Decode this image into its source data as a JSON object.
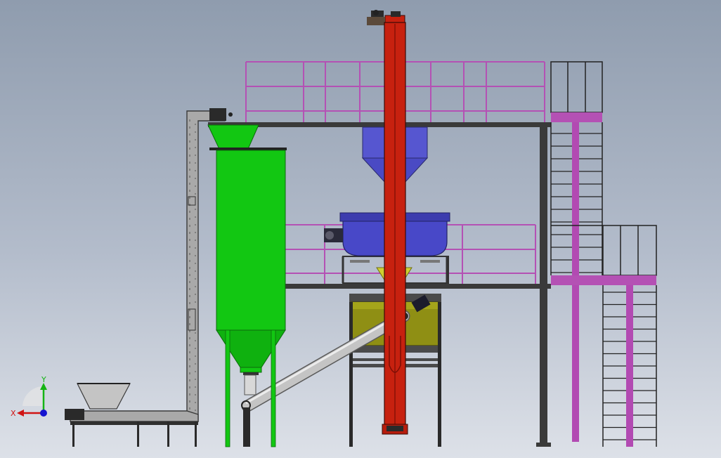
{
  "triad": {
    "x_label": "X",
    "y_label": "Y"
  },
  "colors": {
    "bucket_elevator": "#c7210f",
    "silo": "#12c712",
    "mixer": "#4848c8",
    "hopper_blue": "#5656d0",
    "platform_rails": "#b451b4",
    "stair_stringer": "#b24ab2",
    "packing_machine": "#8f8f14",
    "screw_conveyor": "#c4c4c4",
    "frame_steel": "#3a3a3a",
    "axis_x": "#d01414",
    "axis_y": "#14b414",
    "axis_z": "#1414d0"
  }
}
